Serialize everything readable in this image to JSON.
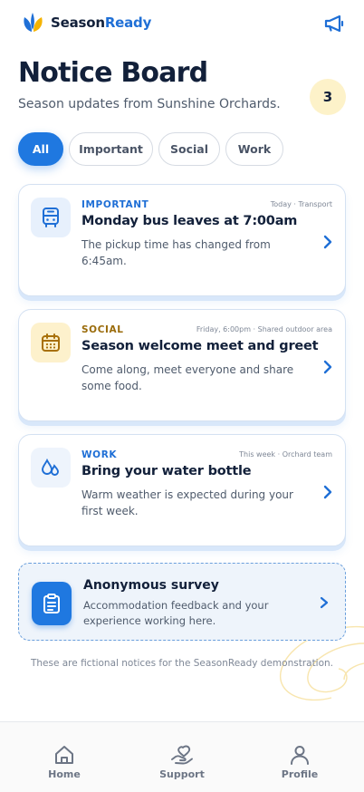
{
  "header": {
    "brand_prefix": "Season",
    "brand_accent": "Ready",
    "logo_icon": "leaf-logo-icon",
    "action_icon": "megaphone-icon"
  },
  "page": {
    "title": "Notice Board",
    "subtitle": "Season updates from Sunshine Orchards.",
    "count": "3"
  },
  "tabs": [
    {
      "label": "All",
      "active": true
    },
    {
      "label": "Important",
      "active": false
    },
    {
      "label": "Social",
      "active": false
    },
    {
      "label": "Work",
      "active": false
    }
  ],
  "notices": [
    {
      "category": "IMPORTANT",
      "category_color": "#1f6fd6",
      "meta": "Today · Transport",
      "title": "Monday bus leaves at 7:00am",
      "description": "The pickup time has changed from 6:45am.",
      "icon": "bus-icon"
    },
    {
      "category": "SOCIAL",
      "category_color": "#9a6b0a",
      "meta": "Friday, 6:00pm · Shared outdoor area",
      "title": "Season welcome meet and greet",
      "description": "Come along, meet everyone and share some food.",
      "icon": "calendar-icon"
    },
    {
      "category": "WORK",
      "category_color": "#1f6fd6",
      "meta": "This week · Orchard team",
      "title": "Bring your water bottle",
      "description": "Warm weather is expected during your first week.",
      "icon": "water-drops-icon"
    }
  ],
  "survey": {
    "title": "Anonymous survey",
    "description": "Accommodation feedback and your experience working here.",
    "icon": "clipboard-icon"
  },
  "footnote": "These are fictional notices for the SeasonReady demonstration.",
  "nav": [
    {
      "label": "Home",
      "icon": "home-icon"
    },
    {
      "label": "Support",
      "icon": "support-hand-icon"
    },
    {
      "label": "Profile",
      "icon": "person-icon"
    }
  ],
  "colors": {
    "primary": "#1f78e0",
    "badge_bg": "#fdf2c9",
    "social_icon_bg": "#fdf1cc"
  }
}
